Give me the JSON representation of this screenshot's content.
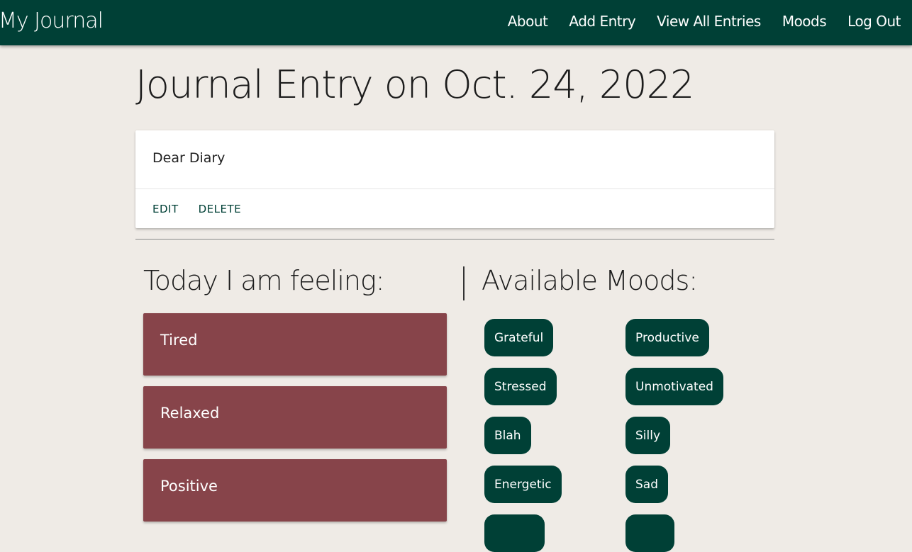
{
  "nav": {
    "brand": "My Journal",
    "links": [
      "About",
      "Add Entry",
      "View All Entries",
      "Moods",
      "Log Out"
    ]
  },
  "page": {
    "title": "Journal Entry on Oct. 24, 2022"
  },
  "entry": {
    "body": "Dear Diary",
    "edit_label": "EDIT",
    "delete_label": "DELETE"
  },
  "feeling": {
    "title": "Today I am feeling:",
    "moods": [
      "Tired",
      "Relaxed",
      "Positive"
    ]
  },
  "available": {
    "title": "Available Moods:",
    "moods": [
      "Grateful",
      "Productive",
      "Stressed",
      "Unmotivated",
      "Blah",
      "Silly",
      "Energetic",
      "Sad",
      "",
      ""
    ]
  },
  "colors": {
    "navbar": "#004036",
    "background": "#efebe6",
    "feeling_card": "#87444a",
    "mood_chip": "#004036"
  }
}
